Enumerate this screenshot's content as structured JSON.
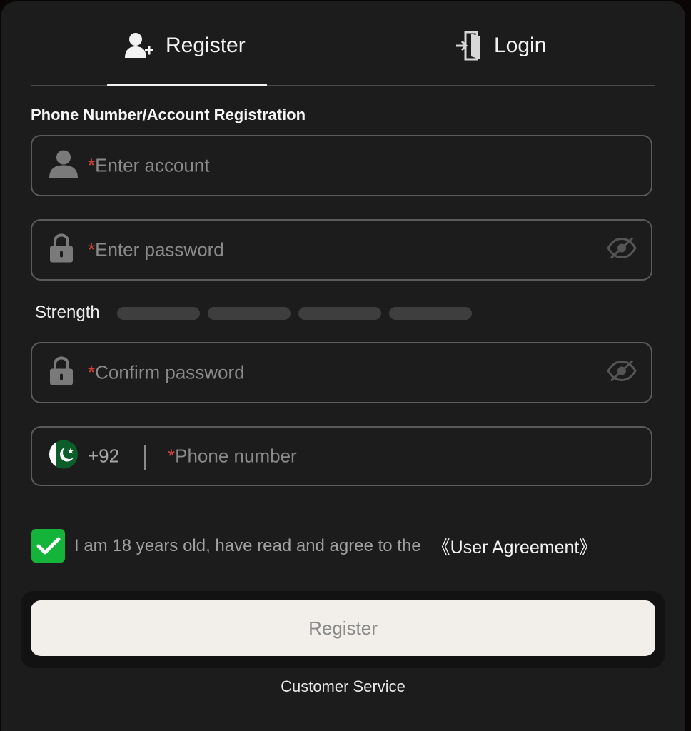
{
  "tabs": {
    "register_label": "Register",
    "login_label": "Login",
    "active": "Register"
  },
  "form": {
    "section_title": "Phone Number/Account Registration",
    "account_placeholder": "Enter account",
    "password_placeholder": "Enter password",
    "confirm_placeholder": "Confirm password",
    "phone_placeholder": "Phone number",
    "phone_code": "+92",
    "required_marker": "*"
  },
  "strength": {
    "label": "Strength",
    "level": 0,
    "segments": 4
  },
  "agreement": {
    "text": "I am 18 years old, have read and agree to the",
    "link": "《User Agreement》",
    "checked": true
  },
  "actions": {
    "register_button": "Register",
    "customer_service": "Customer Service"
  },
  "colors": {
    "background": "#1c1c1c",
    "accent_green": "#14b339",
    "required_red": "#d9413b",
    "button_bg": "#f2efea"
  },
  "icons": {
    "register_tab": "user-plus-icon",
    "login_tab": "login-door-icon",
    "account": "user-icon",
    "password": "lock-icon",
    "visibility": "eye-off-icon",
    "flag": "pakistan-flag-icon",
    "check": "checkmark-icon"
  }
}
